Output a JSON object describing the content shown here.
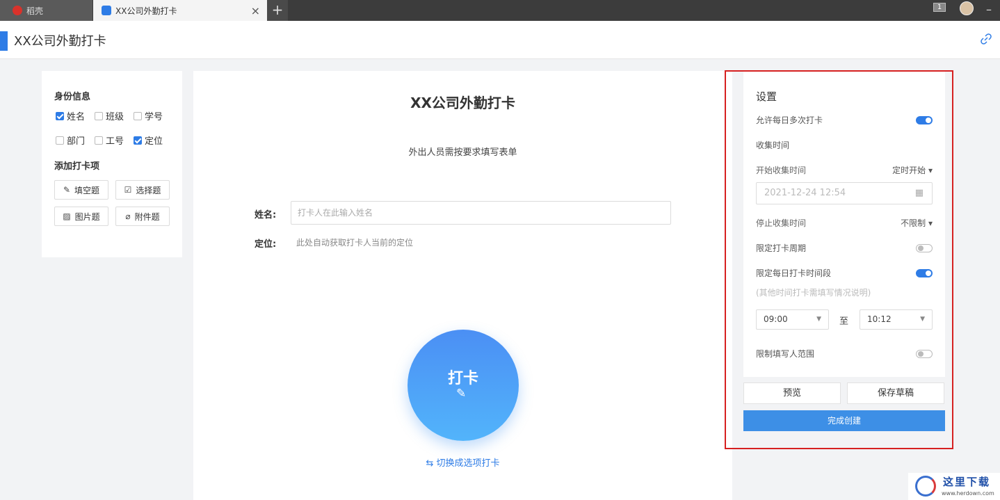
{
  "browser": {
    "tabs": [
      {
        "label": "稻壳"
      },
      {
        "label": "XX公司外勤打卡"
      }
    ],
    "new_tab": "+",
    "close_tab": "×",
    "window_count": "1",
    "minimize": "–"
  },
  "header": {
    "title": "XX公司外勤打卡"
  },
  "left": {
    "identity_title": "身份信息",
    "fields": [
      {
        "label": "姓名",
        "checked": true
      },
      {
        "label": "班级",
        "checked": false
      },
      {
        "label": "学号",
        "checked": false
      },
      {
        "label": "部门",
        "checked": false
      },
      {
        "label": "工号",
        "checked": false
      },
      {
        "label": "定位",
        "checked": true
      }
    ],
    "add_title": "添加打卡项",
    "question_types": [
      {
        "label": "填空题",
        "icon": "pencil-icon"
      },
      {
        "label": "选择题",
        "icon": "checkbox-icon"
      },
      {
        "label": "图片题",
        "icon": "image-icon"
      },
      {
        "label": "附件题",
        "icon": "paperclip-icon"
      }
    ]
  },
  "form": {
    "title": "XX公司外勤打卡",
    "description": "外出人员需按要求填写表单",
    "name_label": "姓名:",
    "name_placeholder": "打卡人在此输入姓名",
    "location_label": "定位:",
    "location_text": "此处自动获取打卡人当前的定位",
    "punch_label": "打卡",
    "switch_link": "切换成选项打卡"
  },
  "settings": {
    "title": "设置",
    "allow_multiple": {
      "label": "允许每日多次打卡",
      "on": true
    },
    "collect_time": "收集时间",
    "start_label": "开始收集时间",
    "start_mode": "定时开始",
    "start_date": "2021-12-24 12:54",
    "stop_label": "停止收集时间",
    "stop_mode": "不限制",
    "limit_period": {
      "label": "限定打卡周期",
      "on": false
    },
    "limit_daily": {
      "label": "限定每日打卡时间段",
      "on": true
    },
    "hint": "(其他时间打卡需填写情况说明)",
    "time_from": "09:00",
    "to_label": "至",
    "time_to": "10:12",
    "limit_range": {
      "label": "限制填写人范围",
      "on": false
    },
    "accent": "#2e7ce6"
  },
  "actions": {
    "preview": "预览",
    "save_draft": "保存草稿",
    "finish": "完成创建"
  },
  "watermark": {
    "title": "这里下载",
    "url": "www.herdown.com"
  }
}
